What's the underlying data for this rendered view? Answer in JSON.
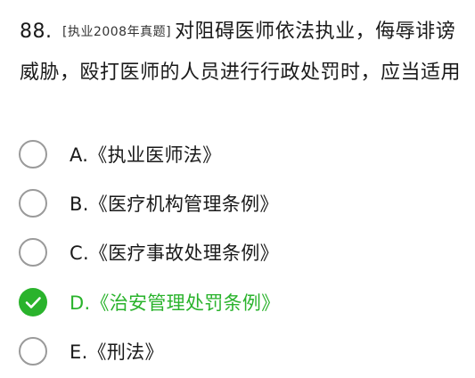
{
  "question": {
    "number": "88.",
    "tag": "[执业2008年真题]",
    "text": "对阻碍医师依法执业，侮辱诽谤威胁，殴打医师的人员进行行政处罚时，应当适用"
  },
  "options": [
    {
      "letter": "A.",
      "text": "《执业医师法》",
      "selected": false
    },
    {
      "letter": "B.",
      "text": "《医疗机构管理条例》",
      "selected": false
    },
    {
      "letter": "C.",
      "text": "《医疗事故处理条例》",
      "selected": false
    },
    {
      "letter": "D.",
      "text": "《治安管理处罚条例》",
      "selected": true
    },
    {
      "letter": "E.",
      "text": "《刑法》",
      "selected": false
    }
  ],
  "colors": {
    "correct": "#2ab32c",
    "radio_border": "#9a9a9a",
    "text": "#1a1a1a"
  },
  "icons": {
    "selected": "checkmark-icon"
  }
}
